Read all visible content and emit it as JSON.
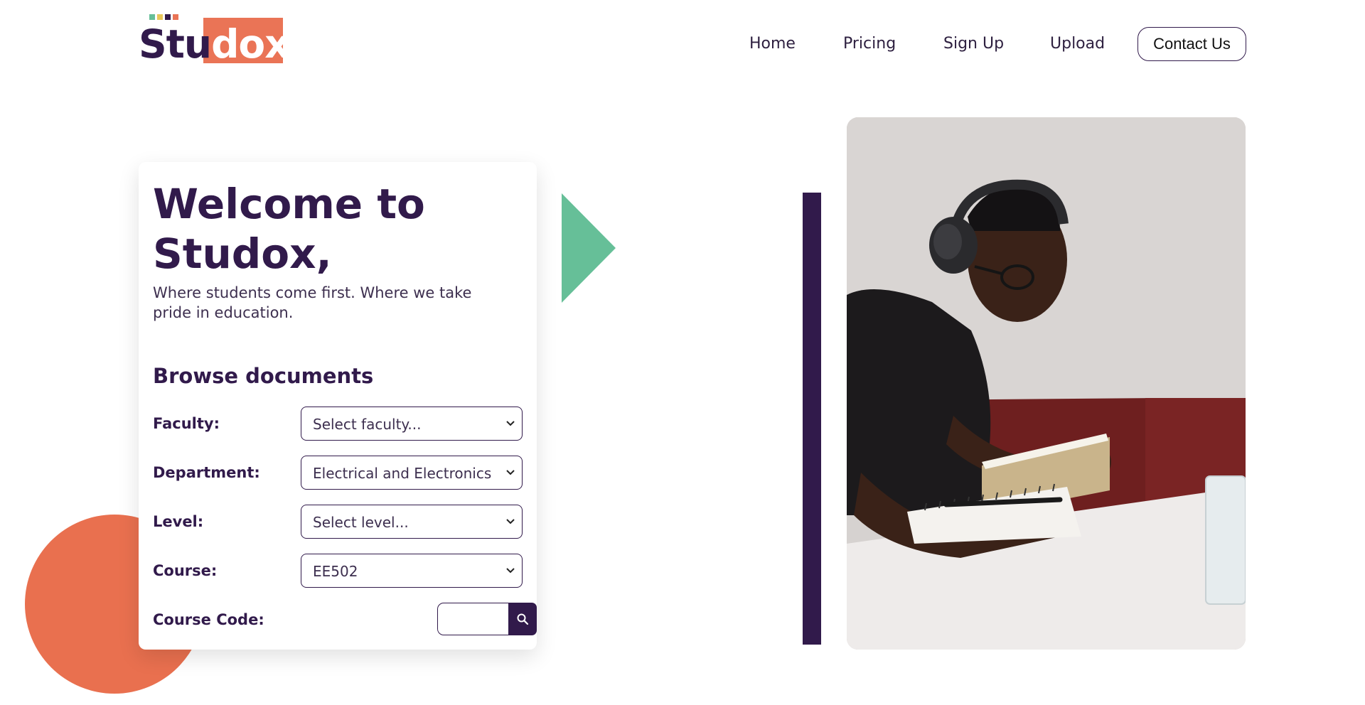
{
  "brand": {
    "part1": "Stu",
    "part2": "dox",
    "dot_colors": [
      "#66bf98",
      "#e9c75a",
      "#311a4b",
      "#ea7456"
    ]
  },
  "nav": {
    "items": [
      {
        "label": "Home"
      },
      {
        "label": "Pricing"
      },
      {
        "label": "Sign Up"
      },
      {
        "label": "Upload"
      }
    ],
    "contact_label": "Contact Us"
  },
  "hero": {
    "title": "Welcome to Studox,",
    "subtitle": "Where students come first. Where we take pride in education.",
    "browse_heading": "Browse documents",
    "fields": {
      "faculty": {
        "label": "Faculty:",
        "value": "Select faculty..."
      },
      "department": {
        "label": "Department:",
        "value": "Electrical and Electronics"
      },
      "level": {
        "label": "Level:",
        "value": "Select level..."
      },
      "course": {
        "label": "Course:",
        "value": "EE502"
      },
      "course_code": {
        "label": "Course Code:",
        "value": "",
        "placeholder": ""
      }
    }
  },
  "colors": {
    "primary": "#311a4b",
    "accent_orange": "#ea7456",
    "accent_green": "#66bf98"
  }
}
